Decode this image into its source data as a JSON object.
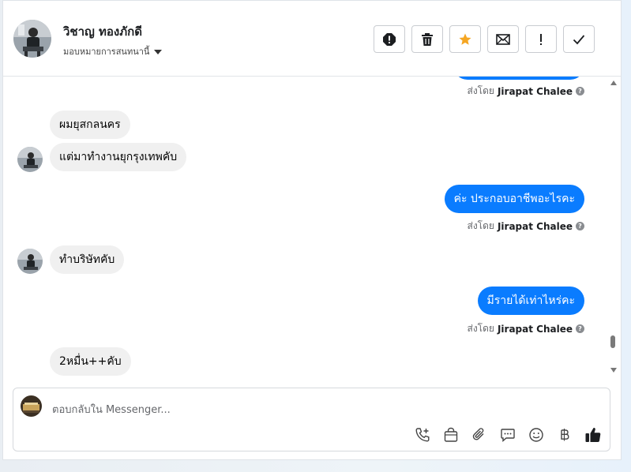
{
  "header": {
    "contact_name": "วิชาญ ทองภักดี",
    "assign_label": "มอบหมายการสนทนานี้"
  },
  "messages": [
    {
      "type": "sent_by",
      "sender": "Jirapat Chalee",
      "prefix": "ส่งโดย"
    },
    {
      "type": "in",
      "text": "ผมยุสกลนคร"
    },
    {
      "type": "in",
      "text": "แต่มาทำงานยุกรุงเทพคับ"
    },
    {
      "type": "out",
      "text": "ค่ะ ประกอบอาชีพอะไรคะ"
    },
    {
      "type": "sent_by",
      "sender": "Jirapat Chalee",
      "prefix": "ส่งโดย"
    },
    {
      "type": "in",
      "text": "ทำบริษัทคับ"
    },
    {
      "type": "out",
      "text": "มีรายได้เท่าไหร่คะ"
    },
    {
      "type": "sent_by",
      "sender": "Jirapat Chalee",
      "prefix": "ส่งโดย"
    },
    {
      "type": "in",
      "text": "2หมื่น++คับ"
    }
  ],
  "composer": {
    "placeholder": "ตอบกลับใน Messenger..."
  },
  "colors": {
    "accent": "#0a7cff",
    "star": "#f5a623",
    "incoming_bubble": "#f0f0f0"
  },
  "icons": {
    "actions": [
      "alert-icon",
      "trash-icon",
      "star-icon",
      "envelope-icon",
      "exclamation-icon",
      "check-icon"
    ],
    "composer_tools": [
      "phone-add-icon",
      "shopping-bag-icon",
      "paperclip-icon",
      "chat-icon",
      "emoji-icon",
      "baht-icon",
      "thumbs-up-icon"
    ]
  }
}
